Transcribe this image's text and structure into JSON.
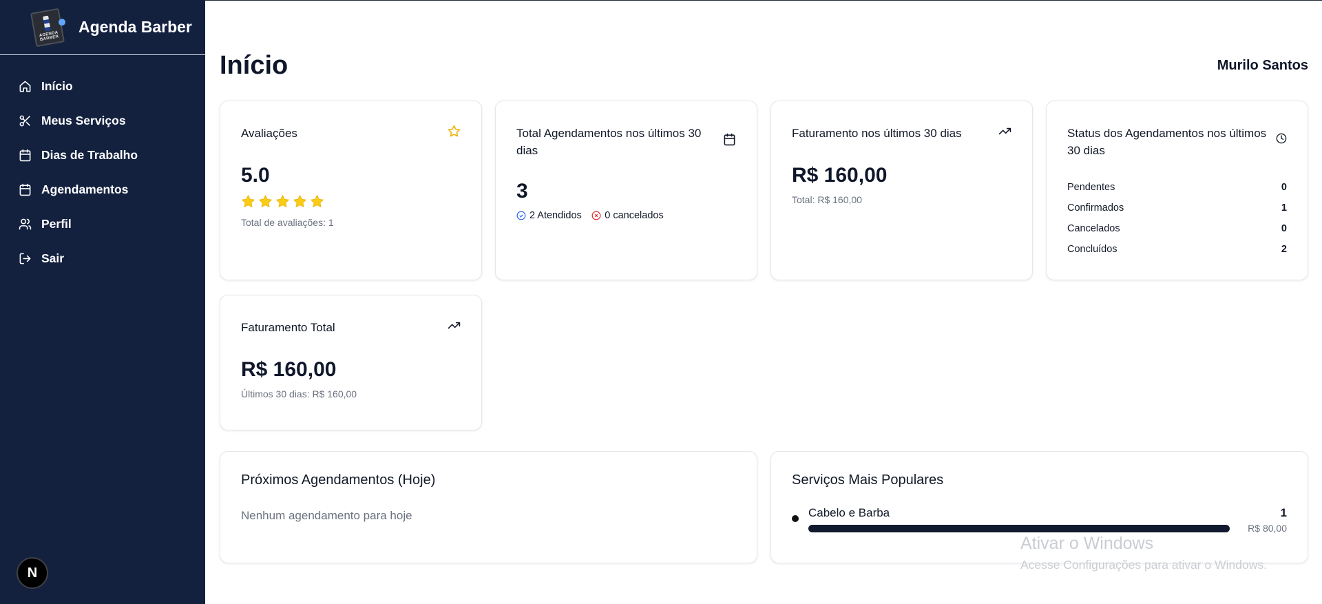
{
  "app": {
    "name": "Agenda Barber",
    "logo_text": "AGENDA BARBER"
  },
  "sidebar": {
    "items": [
      {
        "label": "Início",
        "icon": "home-icon"
      },
      {
        "label": "Meus Serviços",
        "icon": "scissors-icon"
      },
      {
        "label": "Dias de Trabalho",
        "icon": "calendar-icon"
      },
      {
        "label": "Agendamentos",
        "icon": "calendar-icon"
      },
      {
        "label": "Perfil",
        "icon": "users-icon"
      },
      {
        "label": "Sair",
        "icon": "logout-icon"
      }
    ],
    "badge": "N"
  },
  "header": {
    "title": "Início",
    "user": "Murilo Santos"
  },
  "cards": {
    "avaliacoes": {
      "title": "Avaliações",
      "value": "5.0",
      "stars": 5,
      "footer": "Total de avaliações: 1"
    },
    "agendamentos": {
      "title": "Total Agendamentos nos últimos 30 dias",
      "value": "3",
      "atendidos": "2 Atendidos",
      "cancelados": "0 cancelados"
    },
    "faturamento30": {
      "title": "Faturamento nos últimos 30 dias",
      "value": "R$ 160,00",
      "footer": "Total: R$ 160,00"
    },
    "status": {
      "title": "Status dos Agendamentos nos últimos 30 dias",
      "rows": [
        {
          "label": "Pendentes",
          "value": "0"
        },
        {
          "label": "Confirmados",
          "value": "1"
        },
        {
          "label": "Cancelados",
          "value": "0"
        },
        {
          "label": "Concluídos",
          "value": "2"
        }
      ]
    },
    "faturamentoTotal": {
      "title": "Faturamento Total",
      "value": "R$ 160,00",
      "footer": "Últimos 30 dias: R$ 160,00"
    }
  },
  "proximos": {
    "title": "Próximos Agendamentos (Hoje)",
    "empty": "Nenhum agendamento para hoje"
  },
  "populares": {
    "title": "Serviços Mais Populares",
    "items": [
      {
        "name": "Cabelo e Barba",
        "count": "1",
        "price": "R$ 80,00",
        "share": 1.0
      }
    ]
  },
  "watermark": {
    "line1": "Ativar o Windows",
    "line2": "Acesse Configurações para ativar o Windows."
  },
  "colors": {
    "sidebar": "#13213f",
    "star": "#facc15",
    "check": "#2563eb",
    "cancel": "#dc2626"
  }
}
